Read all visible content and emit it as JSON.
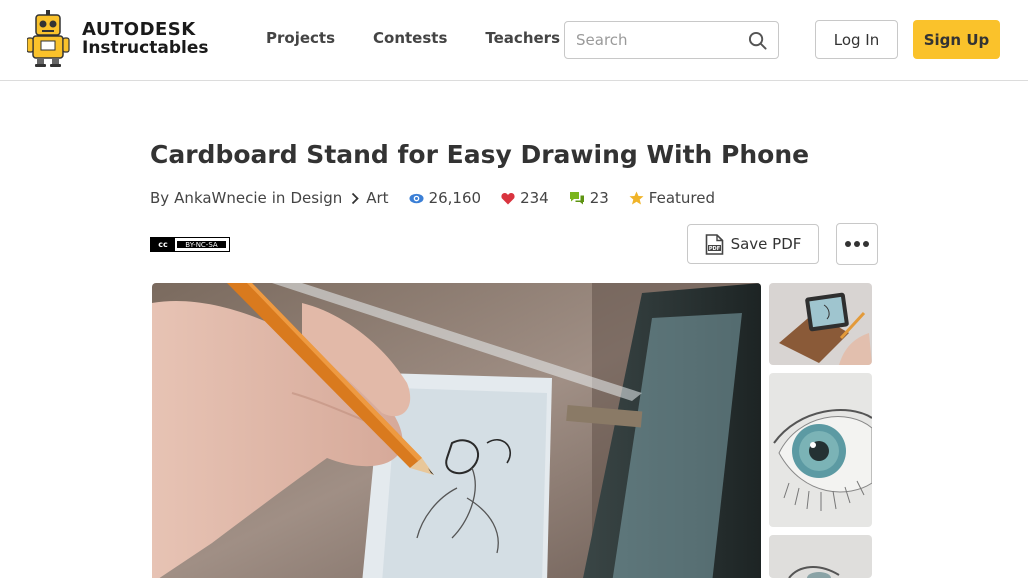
{
  "brand": {
    "line1": "AUTODESK",
    "line2": "Instructables",
    "accent": "#fac22b"
  },
  "nav": {
    "items": [
      {
        "label": "Projects"
      },
      {
        "label": "Contests"
      },
      {
        "label": "Teachers"
      }
    ]
  },
  "search": {
    "placeholder": "Search",
    "value": ""
  },
  "auth": {
    "login_label": "Log In",
    "signup_label": "Sign Up"
  },
  "article": {
    "title": "Cardboard Stand for Easy Drawing With Phone",
    "by_label": "By",
    "author": "AnkaWnecie",
    "in_label": "in",
    "category": "Design",
    "subcategory": "Art",
    "views": "26,160",
    "favorites": "234",
    "comments": "23",
    "featured_label": "Featured",
    "license": {
      "badge": "cc",
      "terms": "BY-NC-SA"
    }
  },
  "actions": {
    "save_pdf_label": "Save PDF"
  },
  "icons": {
    "search": "search-icon",
    "views": "eye-icon",
    "favorites": "heart-icon",
    "comments": "comments-icon",
    "featured": "star-icon",
    "pdf": "pdf-icon",
    "more": "more-options-icon"
  },
  "colors": {
    "views": "#3b7fd6",
    "favorites": "#d9343f",
    "comments": "#7ab51d",
    "featured": "#f0b429"
  }
}
